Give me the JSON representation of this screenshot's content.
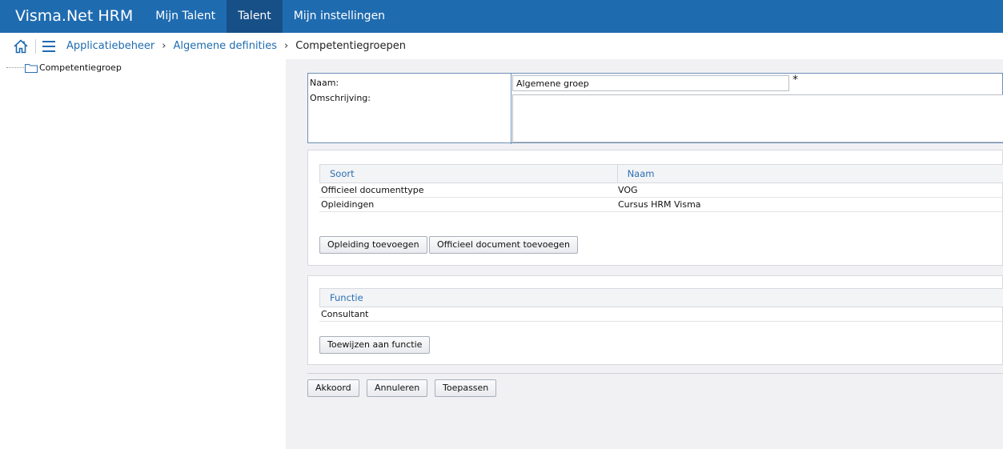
{
  "app": {
    "title": "Visma.Net HRM",
    "nav_tabs": [
      {
        "label": "Mijn Talent",
        "active": false
      },
      {
        "label": "Talent",
        "active": true
      },
      {
        "label": "Mijn instellingen",
        "active": false
      }
    ],
    "brand_color": "#1f6bb0"
  },
  "breadcrumb": {
    "items": [
      "Applicatiebeheer",
      "Algemene definities"
    ],
    "current": "Competentiegroepen",
    "separator": "›"
  },
  "tree": {
    "items": [
      {
        "label": "Competentiegroep",
        "icon": "folder-icon"
      }
    ]
  },
  "form": {
    "naam_label": "Naam:",
    "naam_value": "Algemene groep",
    "required_marker": "*",
    "omschrijving_label": "Omschrijving:",
    "omschrijving_value": ""
  },
  "documents": {
    "columns": [
      "Soort",
      "Naam"
    ],
    "rows": [
      [
        "Officieel documenttype",
        "VOG"
      ],
      [
        "Opleidingen",
        "Cursus HRM Visma"
      ]
    ],
    "add_training_label": "Opleiding toevoegen",
    "add_document_label": "Officieel document toevoegen"
  },
  "functions": {
    "columns": [
      "Functie"
    ],
    "rows": [
      [
        "Consultant"
      ]
    ],
    "assign_label": "Toewijzen aan functie"
  },
  "actions": {
    "ok_label": "Akkoord",
    "cancel_label": "Annuleren",
    "apply_label": "Toepassen"
  }
}
